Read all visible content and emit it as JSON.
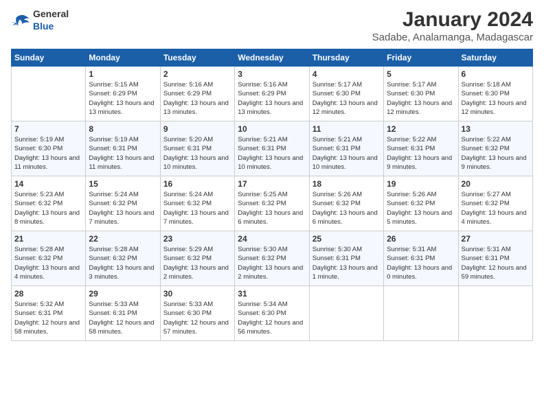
{
  "logo": {
    "general": "General",
    "blue": "Blue"
  },
  "title": "January 2024",
  "location": "Sadabe, Analamanga, Madagascar",
  "headers": [
    "Sunday",
    "Monday",
    "Tuesday",
    "Wednesday",
    "Thursday",
    "Friday",
    "Saturday"
  ],
  "weeks": [
    [
      {
        "day": "",
        "sunrise": "",
        "sunset": "",
        "daylight": ""
      },
      {
        "day": "1",
        "sunrise": "Sunrise: 5:15 AM",
        "sunset": "Sunset: 6:29 PM",
        "daylight": "Daylight: 13 hours and 13 minutes."
      },
      {
        "day": "2",
        "sunrise": "Sunrise: 5:16 AM",
        "sunset": "Sunset: 6:29 PM",
        "daylight": "Daylight: 13 hours and 13 minutes."
      },
      {
        "day": "3",
        "sunrise": "Sunrise: 5:16 AM",
        "sunset": "Sunset: 6:29 PM",
        "daylight": "Daylight: 13 hours and 13 minutes."
      },
      {
        "day": "4",
        "sunrise": "Sunrise: 5:17 AM",
        "sunset": "Sunset: 6:30 PM",
        "daylight": "Daylight: 13 hours and 12 minutes."
      },
      {
        "day": "5",
        "sunrise": "Sunrise: 5:17 AM",
        "sunset": "Sunset: 6:30 PM",
        "daylight": "Daylight: 13 hours and 12 minutes."
      },
      {
        "day": "6",
        "sunrise": "Sunrise: 5:18 AM",
        "sunset": "Sunset: 6:30 PM",
        "daylight": "Daylight: 13 hours and 12 minutes."
      }
    ],
    [
      {
        "day": "7",
        "sunrise": "Sunrise: 5:19 AM",
        "sunset": "Sunset: 6:30 PM",
        "daylight": "Daylight: 13 hours and 11 minutes."
      },
      {
        "day": "8",
        "sunrise": "Sunrise: 5:19 AM",
        "sunset": "Sunset: 6:31 PM",
        "daylight": "Daylight: 13 hours and 11 minutes."
      },
      {
        "day": "9",
        "sunrise": "Sunrise: 5:20 AM",
        "sunset": "Sunset: 6:31 PM",
        "daylight": "Daylight: 13 hours and 10 minutes."
      },
      {
        "day": "10",
        "sunrise": "Sunrise: 5:21 AM",
        "sunset": "Sunset: 6:31 PM",
        "daylight": "Daylight: 13 hours and 10 minutes."
      },
      {
        "day": "11",
        "sunrise": "Sunrise: 5:21 AM",
        "sunset": "Sunset: 6:31 PM",
        "daylight": "Daylight: 13 hours and 10 minutes."
      },
      {
        "day": "12",
        "sunrise": "Sunrise: 5:22 AM",
        "sunset": "Sunset: 6:31 PM",
        "daylight": "Daylight: 13 hours and 9 minutes."
      },
      {
        "day": "13",
        "sunrise": "Sunrise: 5:22 AM",
        "sunset": "Sunset: 6:32 PM",
        "daylight": "Daylight: 13 hours and 9 minutes."
      }
    ],
    [
      {
        "day": "14",
        "sunrise": "Sunrise: 5:23 AM",
        "sunset": "Sunset: 6:32 PM",
        "daylight": "Daylight: 13 hours and 8 minutes."
      },
      {
        "day": "15",
        "sunrise": "Sunrise: 5:24 AM",
        "sunset": "Sunset: 6:32 PM",
        "daylight": "Daylight: 13 hours and 7 minutes."
      },
      {
        "day": "16",
        "sunrise": "Sunrise: 5:24 AM",
        "sunset": "Sunset: 6:32 PM",
        "daylight": "Daylight: 13 hours and 7 minutes."
      },
      {
        "day": "17",
        "sunrise": "Sunrise: 5:25 AM",
        "sunset": "Sunset: 6:32 PM",
        "daylight": "Daylight: 13 hours and 6 minutes."
      },
      {
        "day": "18",
        "sunrise": "Sunrise: 5:26 AM",
        "sunset": "Sunset: 6:32 PM",
        "daylight": "Daylight: 13 hours and 6 minutes."
      },
      {
        "day": "19",
        "sunrise": "Sunrise: 5:26 AM",
        "sunset": "Sunset: 6:32 PM",
        "daylight": "Daylight: 13 hours and 5 minutes."
      },
      {
        "day": "20",
        "sunrise": "Sunrise: 5:27 AM",
        "sunset": "Sunset: 6:32 PM",
        "daylight": "Daylight: 13 hours and 4 minutes."
      }
    ],
    [
      {
        "day": "21",
        "sunrise": "Sunrise: 5:28 AM",
        "sunset": "Sunset: 6:32 PM",
        "daylight": "Daylight: 13 hours and 4 minutes."
      },
      {
        "day": "22",
        "sunrise": "Sunrise: 5:28 AM",
        "sunset": "Sunset: 6:32 PM",
        "daylight": "Daylight: 13 hours and 3 minutes."
      },
      {
        "day": "23",
        "sunrise": "Sunrise: 5:29 AM",
        "sunset": "Sunset: 6:32 PM",
        "daylight": "Daylight: 13 hours and 2 minutes."
      },
      {
        "day": "24",
        "sunrise": "Sunrise: 5:30 AM",
        "sunset": "Sunset: 6:32 PM",
        "daylight": "Daylight: 13 hours and 2 minutes."
      },
      {
        "day": "25",
        "sunrise": "Sunrise: 5:30 AM",
        "sunset": "Sunset: 6:31 PM",
        "daylight": "Daylight: 13 hours and 1 minute."
      },
      {
        "day": "26",
        "sunrise": "Sunrise: 5:31 AM",
        "sunset": "Sunset: 6:31 PM",
        "daylight": "Daylight: 13 hours and 0 minutes."
      },
      {
        "day": "27",
        "sunrise": "Sunrise: 5:31 AM",
        "sunset": "Sunset: 6:31 PM",
        "daylight": "Daylight: 12 hours and 59 minutes."
      }
    ],
    [
      {
        "day": "28",
        "sunrise": "Sunrise: 5:32 AM",
        "sunset": "Sunset: 6:31 PM",
        "daylight": "Daylight: 12 hours and 58 minutes."
      },
      {
        "day": "29",
        "sunrise": "Sunrise: 5:33 AM",
        "sunset": "Sunset: 6:31 PM",
        "daylight": "Daylight: 12 hours and 58 minutes."
      },
      {
        "day": "30",
        "sunrise": "Sunrise: 5:33 AM",
        "sunset": "Sunset: 6:30 PM",
        "daylight": "Daylight: 12 hours and 57 minutes."
      },
      {
        "day": "31",
        "sunrise": "Sunrise: 5:34 AM",
        "sunset": "Sunset: 6:30 PM",
        "daylight": "Daylight: 12 hours and 56 minutes."
      },
      {
        "day": "",
        "sunrise": "",
        "sunset": "",
        "daylight": ""
      },
      {
        "day": "",
        "sunrise": "",
        "sunset": "",
        "daylight": ""
      },
      {
        "day": "",
        "sunrise": "",
        "sunset": "",
        "daylight": ""
      }
    ]
  ]
}
